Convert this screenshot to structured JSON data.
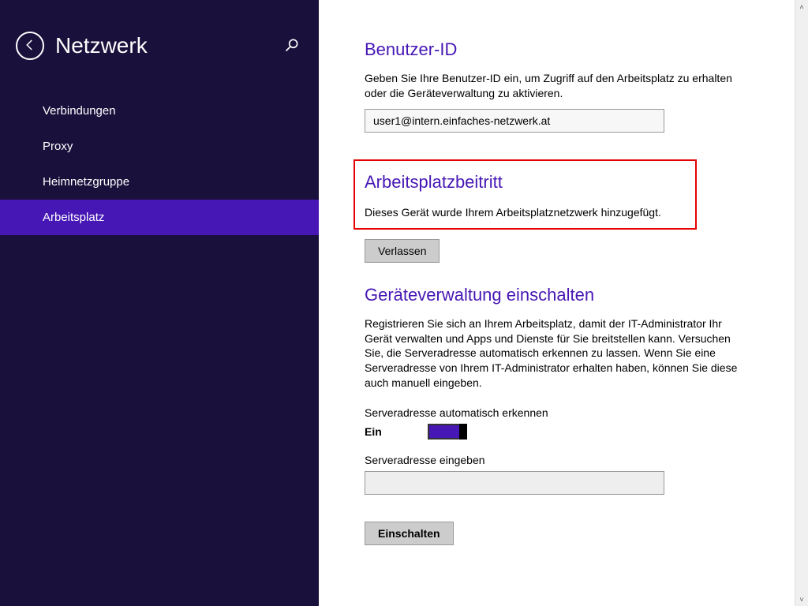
{
  "sidebar": {
    "title": "Netzwerk",
    "items": [
      {
        "label": "Verbindungen",
        "active": false
      },
      {
        "label": "Proxy",
        "active": false
      },
      {
        "label": "Heimnetzgruppe",
        "active": false
      },
      {
        "label": "Arbeitsplatz",
        "active": true
      }
    ]
  },
  "sections": {
    "userid": {
      "heading": "Benutzer-ID",
      "desc": "Geben Sie Ihre Benutzer-ID ein, um Zugriff auf den Arbeitsplatz zu erhalten oder die Geräteverwaltung zu aktivieren.",
      "value": "user1@intern.einfaches-netzwerk.at"
    },
    "workplace": {
      "heading": "Arbeitsplatzbeitritt",
      "desc": "Dieses Gerät wurde Ihrem Arbeitsplatznetzwerk hinzugefügt.",
      "leave_label": "Verlassen"
    },
    "device": {
      "heading": "Geräteverwaltung einschalten",
      "desc": "Registrieren Sie sich an Ihrem Arbeitsplatz, damit der IT-Administrator Ihr Gerät verwalten und Apps und Dienste für Sie breitstellen kann. Versuchen Sie, die Serveradresse automatisch erkennen zu lassen. Wenn Sie eine Serveradresse von Ihrem IT-Administrator erhalten haben, können Sie diese auch manuell eingeben.",
      "auto_label": "Serveradresse automatisch erkennen",
      "toggle_state": "Ein",
      "server_label": "Serveradresse eingeben",
      "server_value": "",
      "enable_label": "Einschalten"
    }
  }
}
